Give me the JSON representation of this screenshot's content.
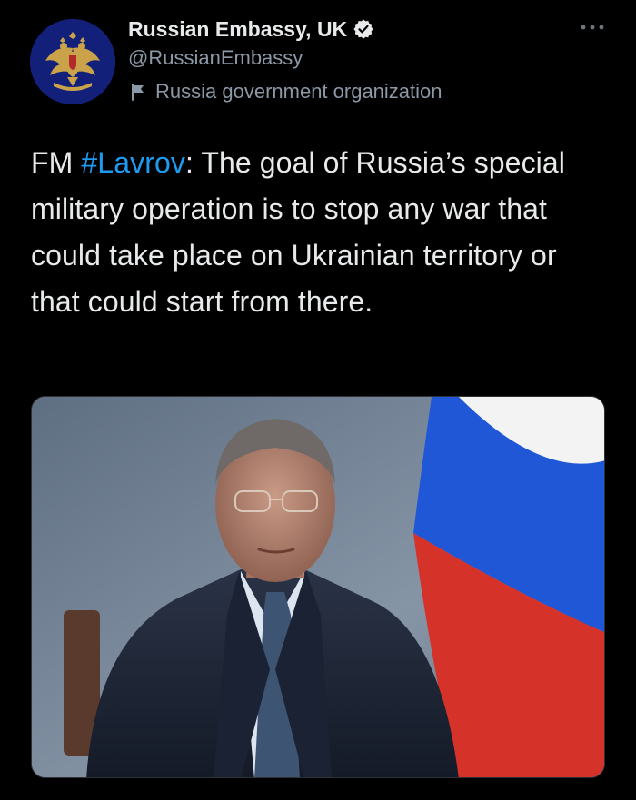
{
  "author": {
    "display_name": "Russian Embassy, UK",
    "handle": "@RussianEmbassy",
    "affiliation": "Russia government organization",
    "avatar_icon": "double-headed-eagle-emblem",
    "verified_icon": "verified-badge-icon",
    "affiliation_icon": "flag-icon"
  },
  "tweet": {
    "text_prefix": "FM ",
    "hashtag": "#Lavrov",
    "text_body": ": The goal of Russia’s special military operation is to stop any war that could take place on Ukrainian territory or that could start from there."
  },
  "media": {
    "kind": "photo",
    "description_icon": "portrait-with-russian-flag"
  },
  "menu": {
    "icon": "more-options-icon"
  },
  "colors": {
    "background": "#000000",
    "primary_text": "#e7e9ea",
    "secondary_text": "#8b98a5",
    "link": "#1d9bf0",
    "avatar_bg": "#13207a",
    "emblem_gold": "#c9a24a",
    "flag_white": "#f3f3f3",
    "flag_blue": "#1f57d6",
    "flag_red": "#d5322a"
  }
}
